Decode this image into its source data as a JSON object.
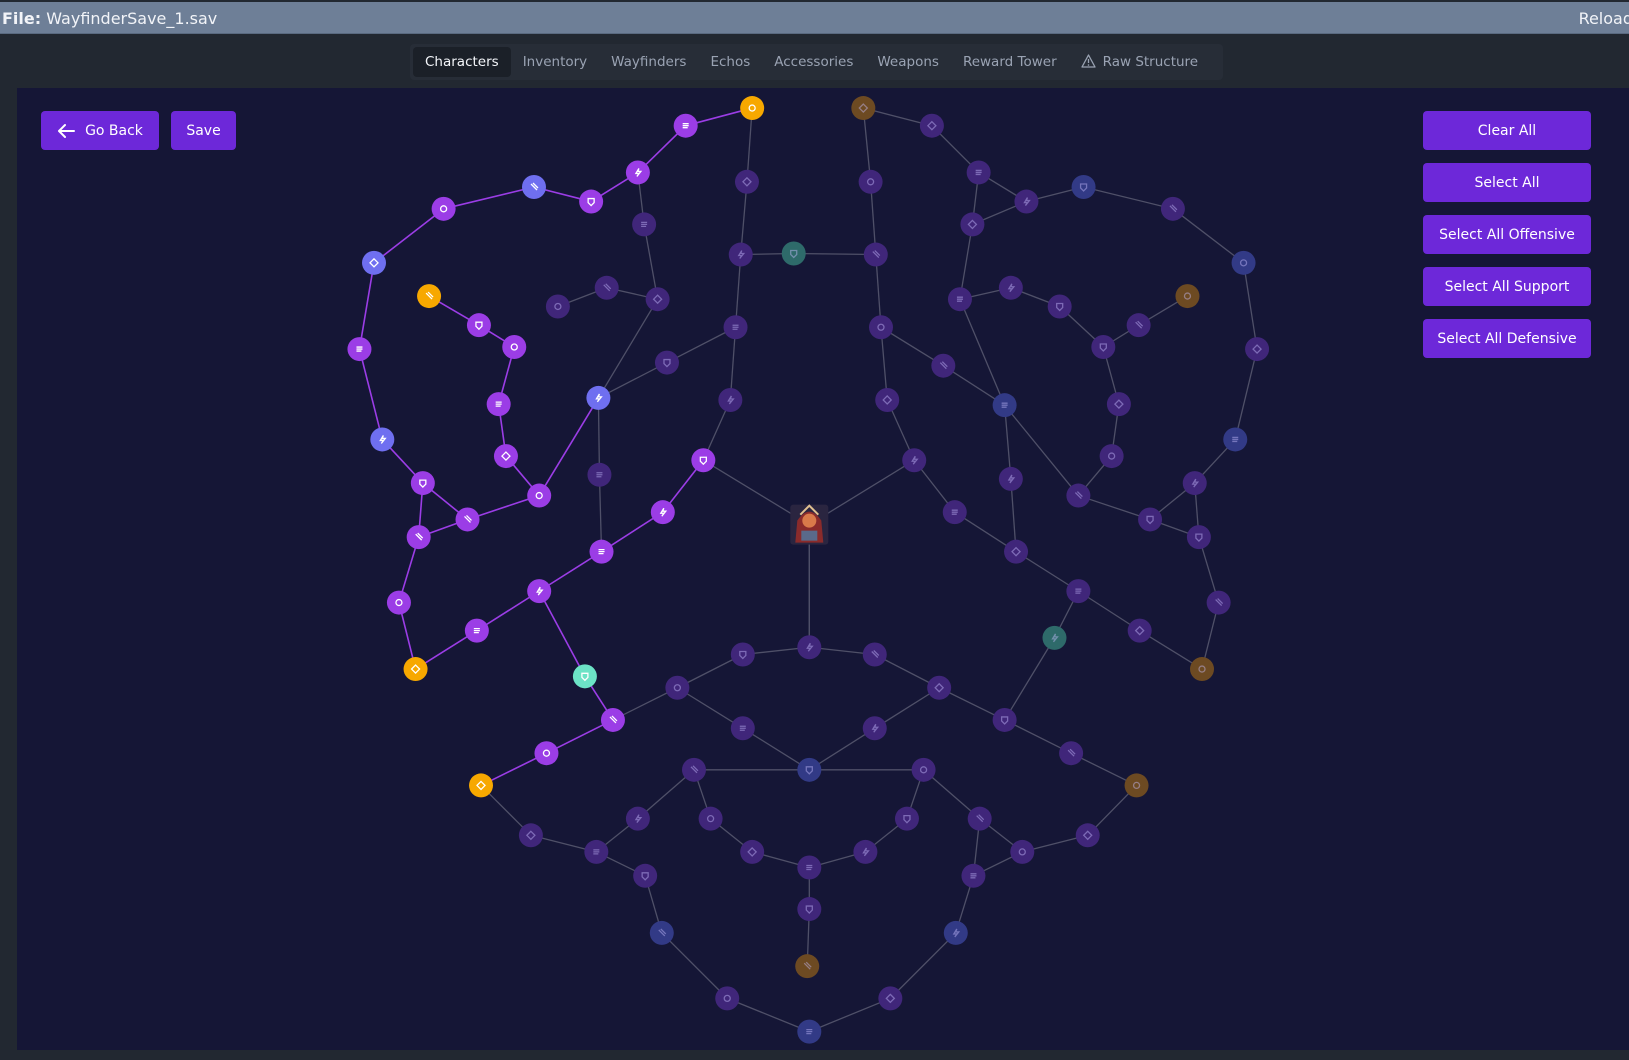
{
  "titlebar": {
    "file_label": "File:",
    "file_name": "WayfinderSave_1.sav",
    "reload_label": "Reload"
  },
  "tabs": [
    {
      "label": "Characters",
      "active": true
    },
    {
      "label": "Inventory"
    },
    {
      "label": "Wayfinders"
    },
    {
      "label": "Echos"
    },
    {
      "label": "Accessories"
    },
    {
      "label": "Weapons"
    },
    {
      "label": "Reward Tower"
    },
    {
      "label": "Raw Structure",
      "icon": "warning-icon"
    }
  ],
  "actions": {
    "go_back": "Go Back",
    "save": "Save",
    "clear_all": "Clear All",
    "select_all": "Select All",
    "select_offensive": "Select All Offensive",
    "select_support": "Select All Support",
    "select_defensive": "Select All Defensive"
  },
  "colors": {
    "accent": "#6d28d9",
    "node_selected": "#9b3de6",
    "node_selected_blue": "#6f6ff0",
    "node_unselected": "#40267a",
    "node_unselected_blue": "#323a86",
    "node_gold": "#f7a800",
    "node_gold_dim": "#6d4a22",
    "node_teal": "#6ce3c6",
    "node_teal_dim": "#2e6a6a",
    "edge_selected": "#9b3de6",
    "edge_unselected": "#4f5068"
  },
  "center_avatar": "character-portrait",
  "tree": {
    "nodes": [
      {
        "id": "center",
        "type": "center"
      },
      {
        "id": "n1",
        "type": "gold",
        "sel": true,
        "icon": "star-icon"
      },
      {
        "id": "n2",
        "type": "gold",
        "sel": false,
        "icon": "rune-icon"
      },
      {
        "id": "n3",
        "type": "purple",
        "sel": true,
        "icon": "slash-icon"
      },
      {
        "id": "n4",
        "type": "purple",
        "sel": true,
        "icon": "ring-icon"
      },
      {
        "id": "n5",
        "type": "purple",
        "sel": true,
        "icon": "shield-icon"
      },
      {
        "id": "n6",
        "type": "blue",
        "sel": true,
        "icon": "bolt-icon"
      },
      {
        "id": "n7",
        "type": "purple",
        "sel": true,
        "icon": "slash-icon"
      },
      {
        "id": "n8",
        "type": "blue",
        "sel": true,
        "icon": "down-arrow-icon"
      },
      {
        "id": "n9",
        "type": "purple",
        "sel": true,
        "icon": "diamond-icon"
      },
      {
        "id": "n10",
        "type": "blue",
        "sel": true,
        "icon": "bolt-icon"
      },
      {
        "id": "n11",
        "type": "purple",
        "sel": true,
        "icon": "slash-icon"
      },
      {
        "id": "n12",
        "type": "purple",
        "sel": true,
        "icon": "ring-icon"
      },
      {
        "id": "n13",
        "type": "purple",
        "sel": true,
        "icon": "shield-icon"
      },
      {
        "id": "n14",
        "type": "gold",
        "sel": true,
        "icon": "hand-icon"
      },
      {
        "id": "n15",
        "type": "purple",
        "sel": true,
        "icon": "slash-icon"
      },
      {
        "id": "n16",
        "type": "purple",
        "sel": true,
        "icon": "diamond-icon"
      },
      {
        "id": "n17",
        "type": "teal",
        "sel": true,
        "icon": "anchor-icon"
      },
      {
        "id": "n18",
        "type": "purple",
        "sel": true,
        "icon": "shield-icon"
      },
      {
        "id": "n19",
        "type": "purple",
        "sel": true,
        "icon": "lines-icon"
      },
      {
        "id": "n20",
        "type": "gold",
        "sel": true,
        "icon": "fist-icon"
      },
      {
        "id": "n21",
        "type": "purple",
        "sel": true,
        "icon": "ring-icon"
      },
      {
        "id": "n22",
        "type": "purple",
        "sel": true,
        "icon": "slash-icon"
      },
      {
        "id": "n23",
        "type": "purple",
        "sel": true,
        "icon": "slash-icon"
      },
      {
        "id": "n24",
        "type": "purple",
        "sel": true,
        "icon": "slash-icon"
      },
      {
        "id": "n25",
        "type": "purple",
        "sel": true,
        "icon": "slash-icon"
      },
      {
        "id": "n26",
        "type": "purple",
        "sel": true,
        "icon": "lines-icon"
      },
      {
        "id": "n27",
        "type": "purple",
        "sel": true,
        "icon": "diamond-icon"
      },
      {
        "id": "n28",
        "type": "blue",
        "sel": true,
        "icon": "bolt-icon"
      },
      {
        "id": "n29",
        "type": "purple",
        "sel": true,
        "icon": "ring-icon"
      },
      {
        "id": "n30",
        "type": "gold",
        "sel": true,
        "icon": "mask-icon"
      },
      {
        "id": "n31",
        "type": "purple",
        "sel": true,
        "icon": "slash-icon"
      }
    ]
  }
}
